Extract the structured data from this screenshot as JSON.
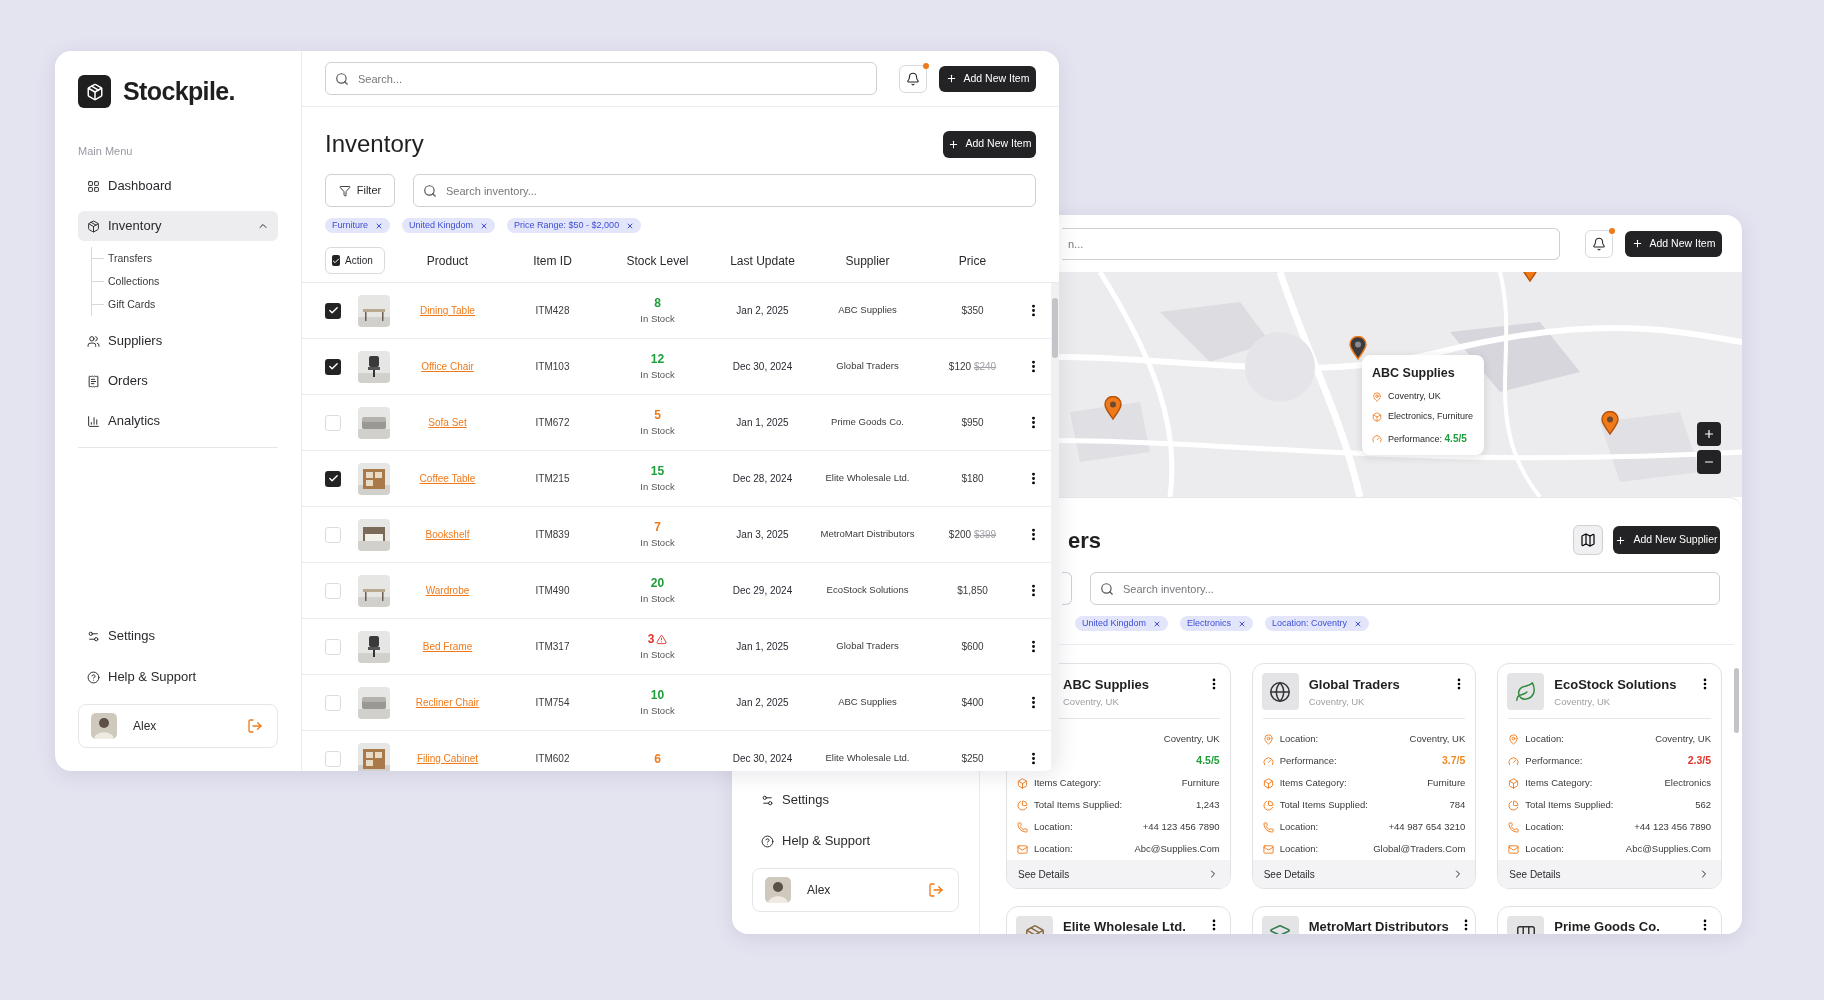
{
  "inventory_window": {
    "brand": "Stockpile.",
    "menu_heading": "Main Menu",
    "nav": [
      {
        "label": "Dashboard",
        "selected": false
      },
      {
        "label": "Inventory",
        "selected": true,
        "expanded": true,
        "children": [
          {
            "label": "Transfers"
          },
          {
            "label": "Collections"
          },
          {
            "label": "Gift Cards"
          }
        ]
      },
      {
        "label": "Suppliers",
        "selected": false
      },
      {
        "label": "Orders",
        "selected": false
      },
      {
        "label": "Analytics",
        "selected": false
      }
    ],
    "footer_nav": [
      {
        "label": "Settings"
      },
      {
        "label": "Help & Support"
      }
    ],
    "user": {
      "name": "Alex"
    },
    "search": {
      "placeholder": "Search..."
    },
    "notifications": {
      "unread": true
    },
    "header_button": "Add New Item",
    "title": "Inventory",
    "add_button": "Add New Item",
    "filter_button": "Filter",
    "table_search": {
      "placeholder": "Search inventory..."
    },
    "chips": [
      "Furniture",
      "United Kingdom",
      "Price Range: $50 - $2,000"
    ],
    "table": {
      "select_all": {
        "checked": true,
        "label": "Action"
      },
      "columns": [
        "Product",
        "Item ID",
        "Stock Level",
        "Last Update",
        "Supplier",
        "Price"
      ],
      "rows": [
        {
          "selected": true,
          "product": "Dining Table",
          "item_id": "ITM428",
          "stock": "8",
          "color": "#1e9e3a",
          "warning": false,
          "status": "In Stock",
          "updated": "Jan 2, 2025",
          "supplier": "ABC Supplies",
          "price": "$350"
        },
        {
          "selected": true,
          "product": "Office Chair",
          "item_id": "ITM103",
          "stock": "12",
          "color": "#1e9e3a",
          "warning": false,
          "status": "In Stock",
          "updated": "Dec 30, 2024",
          "supplier": "Global Traders",
          "price": "$120",
          "old_price": "$240"
        },
        {
          "selected": false,
          "product": "Sofa Set",
          "item_id": "ITM672",
          "stock": "5",
          "color": "#f07a1a",
          "warning": false,
          "status": "In Stock",
          "updated": "Jan 1, 2025",
          "supplier": "Prime Goods Co.",
          "price": "$950"
        },
        {
          "selected": true,
          "product": "Coffee Table",
          "item_id": "ITM215",
          "stock": "15",
          "color": "#1e9e3a",
          "warning": false,
          "status": "In Stock",
          "updated": "Dec 28, 2024",
          "supplier": "Elite Wholesale Ltd.",
          "price": "$180"
        },
        {
          "selected": false,
          "product": "Bookshelf",
          "item_id": "ITM839",
          "stock": "7",
          "color": "#f07a1a",
          "warning": false,
          "status": "In Stock",
          "updated": "Jan 3, 2025",
          "supplier": "MetroMart Distributors",
          "price": "$200",
          "old_price": "$399"
        },
        {
          "selected": false,
          "product": "Wardrobe",
          "item_id": "ITM490",
          "stock": "20",
          "color": "#1e9e3a",
          "warning": false,
          "status": "In Stock",
          "updated": "Dec 29, 2024",
          "supplier": "EcoStock Solutions",
          "price": "$1,850"
        },
        {
          "selected": false,
          "product": "Bed Frame",
          "item_id": "ITM317",
          "stock": "3",
          "color": "#e0342b",
          "warning": true,
          "status": "In Stock",
          "updated": "Jan 1, 2025",
          "supplier": "Global Traders",
          "price": "$600"
        },
        {
          "selected": false,
          "product": "Recliner Chair",
          "item_id": "ITM754",
          "stock": "10",
          "color": "#1e9e3a",
          "warning": false,
          "status": "In Stock",
          "updated": "Jan 2, 2025",
          "supplier": "ABC Supplies",
          "price": "$400"
        },
        {
          "selected": false,
          "product": "Filing Cabinet",
          "item_id": "ITM602",
          "stock": "6",
          "color": "#f07a1a",
          "warning": false,
          "updated": "Dec 30, 2024",
          "supplier": "Elite Wholesale Ltd.",
          "price": "$250"
        }
      ]
    }
  },
  "suppliers_window": {
    "footer_nav": [
      {
        "label": "Settings"
      },
      {
        "label": "Help & Support"
      }
    ],
    "user": {
      "name": "Alex"
    },
    "search": {
      "placeholder": "n..."
    },
    "notifications": {
      "unread": true
    },
    "header_button": "Add New Item",
    "map": {
      "pins": [
        {
          "selected": false
        },
        {
          "selected": true
        },
        {
          "selected": false
        },
        {
          "selected": false
        }
      ],
      "popup": {
        "name": "ABC Supplies",
        "location": "Coventry, UK",
        "category": "Electronics, Furniture",
        "performance_label": "Performance:",
        "performance": "4.5/5",
        "color": "#1e9e3a"
      }
    },
    "title": "ers",
    "add_button": "Add New Supplier",
    "search_field": {
      "placeholder": "Search inventory..."
    },
    "chips": [
      "United Kingdom",
      "Electronics",
      "Location: Coventry"
    ],
    "cards": [
      {
        "name": "ABC Supplies",
        "subtitle": "Coventry, UK",
        "link": "See Details",
        "details": [
          {
            "value": "Coventry, UK"
          },
          {
            "value": "4.5/5",
            "color": "#1e9e3a"
          },
          {
            "label": "Items Category:",
            "value": "Furniture"
          },
          {
            "label": "Total Items Supplied:",
            "value": "1,243"
          },
          {
            "label": "Location:",
            "value": "+44 123 456 7890"
          },
          {
            "label": "Location:",
            "value": "Abc@Supplies.Com"
          }
        ]
      },
      {
        "name": "Global Traders",
        "subtitle": "Coventry, UK",
        "link": "See Details",
        "details": [
          {
            "label": "Location:",
            "value": "Coventry, UK"
          },
          {
            "label": "Performance:",
            "value": "3.7/5",
            "color": "#f08a24"
          },
          {
            "label": "Items Category:",
            "value": "Furniture"
          },
          {
            "label": "Total Items Supplied:",
            "value": "784"
          },
          {
            "label": "Location:",
            "value": "+44 987 654 3210"
          },
          {
            "label": "Location:",
            "value": "Global@Traders.Com"
          }
        ]
      },
      {
        "name": "EcoStock Solutions",
        "subtitle": "Coventry, UK",
        "link": "See Details",
        "details": [
          {
            "label": "Location:",
            "value": "Coventry, UK"
          },
          {
            "label": "Performance:",
            "value": "2.3/5",
            "color": "#e0342b"
          },
          {
            "label": "Items Category:",
            "value": "Electronics"
          },
          {
            "label": "Total Items Supplied:",
            "value": "562"
          },
          {
            "label": "Location:",
            "value": "+44 123 456 7890"
          },
          {
            "label": "Location:",
            "value": "Abc@Supplies.Com"
          }
        ]
      }
    ],
    "more_cards": [
      {
        "name": "Elite Wholesale Ltd."
      },
      {
        "name": "MetroMart Distributors"
      },
      {
        "name": "Prime Goods Co."
      }
    ]
  }
}
